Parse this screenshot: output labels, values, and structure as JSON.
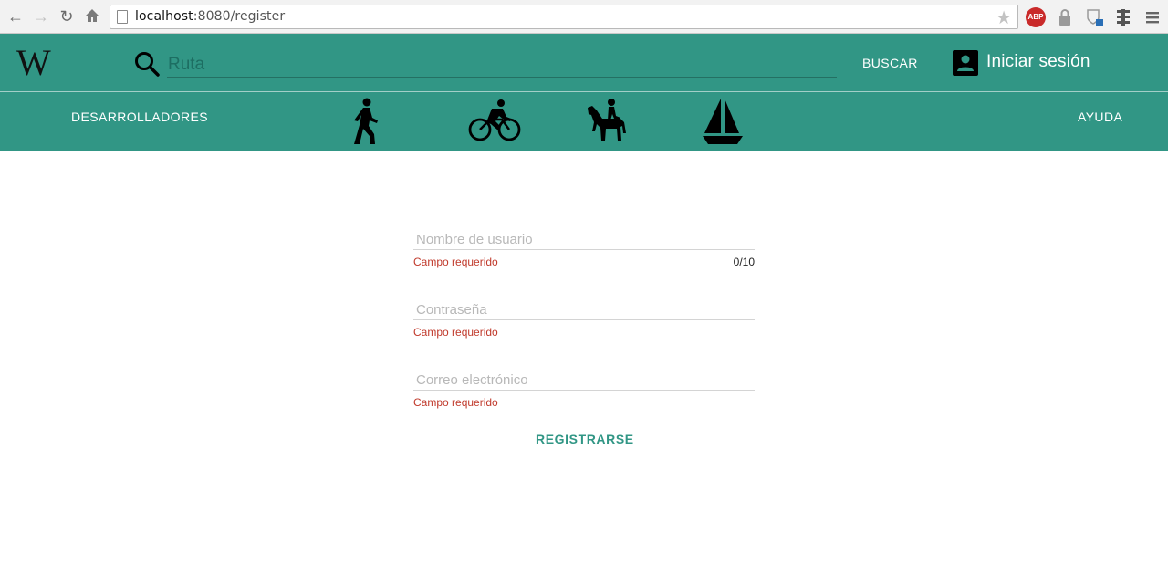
{
  "browser": {
    "url_host": "localhost",
    "url_rest": ":8080/register",
    "abp_label": "ABP"
  },
  "header": {
    "logo": "W",
    "search_placeholder": "Ruta",
    "search_button": "BUSCAR",
    "login_label": "Iniciar sesión",
    "developers_link": "DESARROLLADORES",
    "help_link": "AYUDA",
    "modes": [
      "walking-icon",
      "bicycle-icon",
      "horse-riding-icon",
      "sailboat-icon"
    ]
  },
  "form": {
    "username": {
      "placeholder": "Nombre de usuario",
      "error": "Campo requerido",
      "counter": "0/10"
    },
    "password": {
      "placeholder": "Contraseña",
      "error": "Campo requerido"
    },
    "email": {
      "placeholder": "Correo electrónico",
      "error": "Campo requerido"
    },
    "submit_label": "REGISTRARSE"
  },
  "colors": {
    "primary": "#319685",
    "error": "#c0392b"
  }
}
